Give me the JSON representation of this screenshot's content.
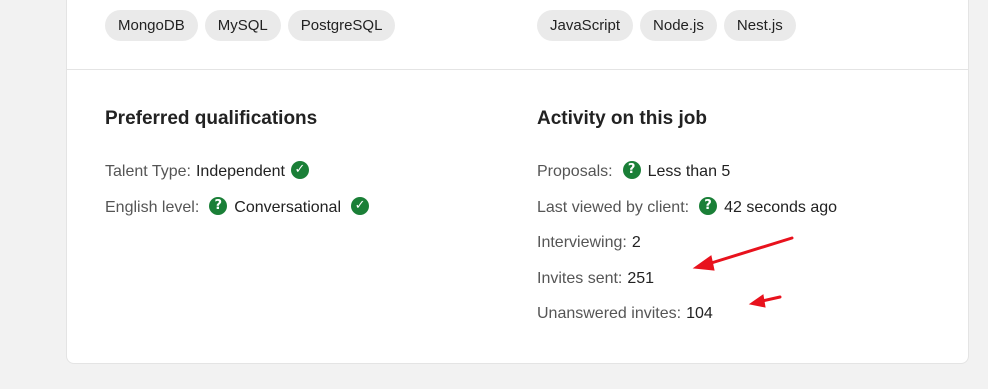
{
  "skills_left": [
    "MongoDB",
    "MySQL",
    "PostgreSQL"
  ],
  "skills_right": [
    "JavaScript",
    "Node.js",
    "Nest.js"
  ],
  "preferred": {
    "title": "Preferred qualifications",
    "talent_type_label": "Talent Type:",
    "talent_type_value": "Independent",
    "english_label": "English level:",
    "english_value": "Conversational"
  },
  "activity": {
    "title": "Activity on this job",
    "proposals_label": "Proposals:",
    "proposals_value": "Less than 5",
    "last_viewed_label": "Last viewed by client:",
    "last_viewed_value": "42 seconds ago",
    "interviewing_label": "Interviewing:",
    "interviewing_value": "2",
    "invites_sent_label": "Invites sent:",
    "invites_sent_value": "251",
    "unanswered_label": "Unanswered invites:",
    "unanswered_value": "104"
  },
  "icons": {
    "check": "check-circle-icon",
    "question": "question-circle-icon",
    "status_color": "#1a7f37",
    "annotation_color": "#e8121d"
  }
}
